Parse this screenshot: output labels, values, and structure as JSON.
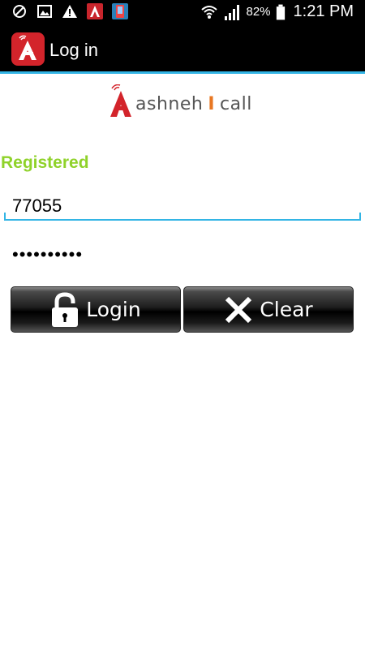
{
  "status_bar": {
    "left_icons": [
      "blocked-icon",
      "image-icon",
      "warning-icon",
      "ashneh-app-icon",
      "phone-app-icon"
    ],
    "right_icons": [
      "wifi-icon",
      "signal-icon",
      "battery-icon"
    ],
    "battery_percent": "82%",
    "time": "1:21 PM"
  },
  "action_bar": {
    "title": "Log in",
    "accent_color": "#33b5e5"
  },
  "logo": {
    "text": "ashneh",
    "separator": "I",
    "suffix": "call"
  },
  "status": {
    "text": "Registered",
    "color": "#8fd22a"
  },
  "form": {
    "username_value": "77055",
    "password_value": "••••••••••"
  },
  "buttons": {
    "login_label": "Login",
    "clear_label": "Clear"
  }
}
